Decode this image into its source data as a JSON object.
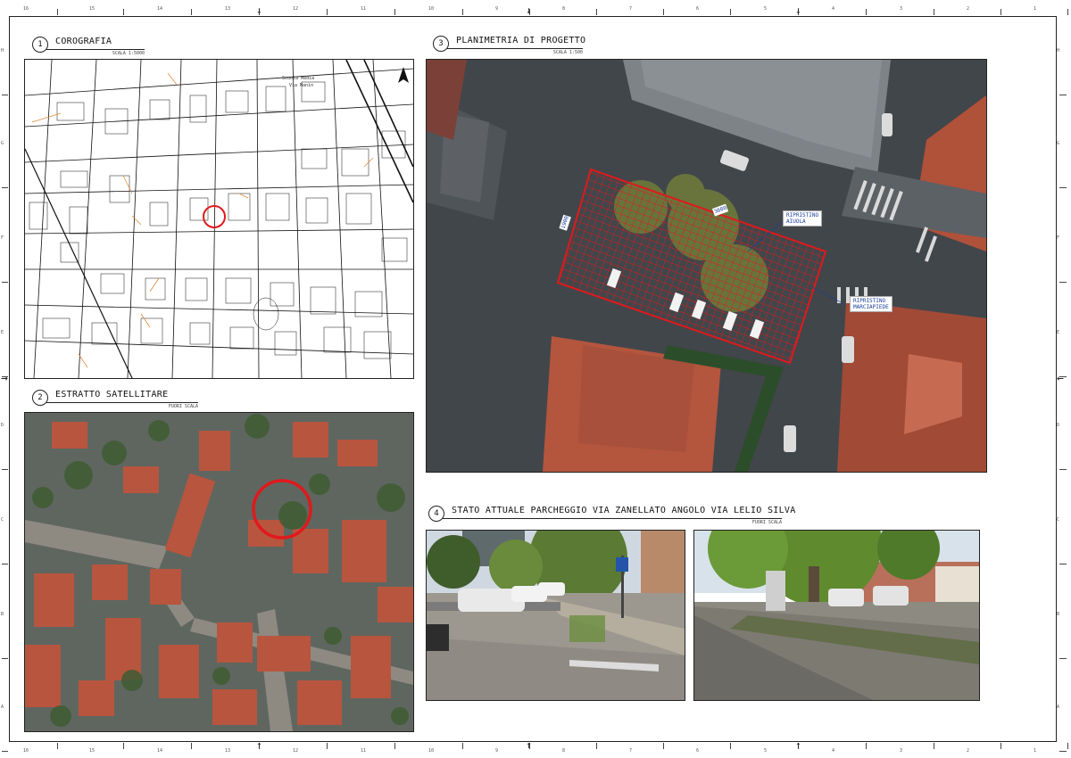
{
  "sections": {
    "corografia": {
      "num": "1",
      "title": "COROGRAFIA",
      "scale": "SCALA 1:5000"
    },
    "estratto": {
      "num": "2",
      "title": "ESTRATTO SATELLITARE",
      "scale": "FUORI SCALA"
    },
    "planimetria": {
      "num": "3",
      "title": "PLANIMETRIA DI PROGETTO",
      "scale": "SCALA 1:500"
    },
    "stato": {
      "num": "4",
      "title": "STATO ATTUALE PARCHEGGIO VIA ZANELLATO ANGOLO VIA LELIO SILVA",
      "scale": "FUORI SCALA"
    }
  },
  "callouts": {
    "ripristino_aiuola": "RIPRISTINO\nAIUOLA",
    "ripristino_marciapiede": "RIPRISTINO\nMARCIAPIEDE",
    "dim_left": "1900",
    "dim_top": "3600"
  },
  "map_labels": {
    "l1": "Scuola Media",
    "l2": "Via Manin"
  },
  "ruler": {
    "top": [
      "16",
      "15",
      "14",
      "13",
      "12",
      "11",
      "10",
      "9",
      "8",
      "7",
      "6",
      "5",
      "4",
      "3",
      "2",
      "1"
    ],
    "side": [
      "H",
      "G",
      "F",
      "E",
      "D",
      "C",
      "B",
      "A"
    ]
  },
  "colors": {
    "red_marker": "#e0191c",
    "callout_text": "#1a3f9a",
    "roof": "#b8553e"
  },
  "icons": {
    "north": "north-arrow-icon",
    "marker": "red-circle-marker-icon"
  }
}
